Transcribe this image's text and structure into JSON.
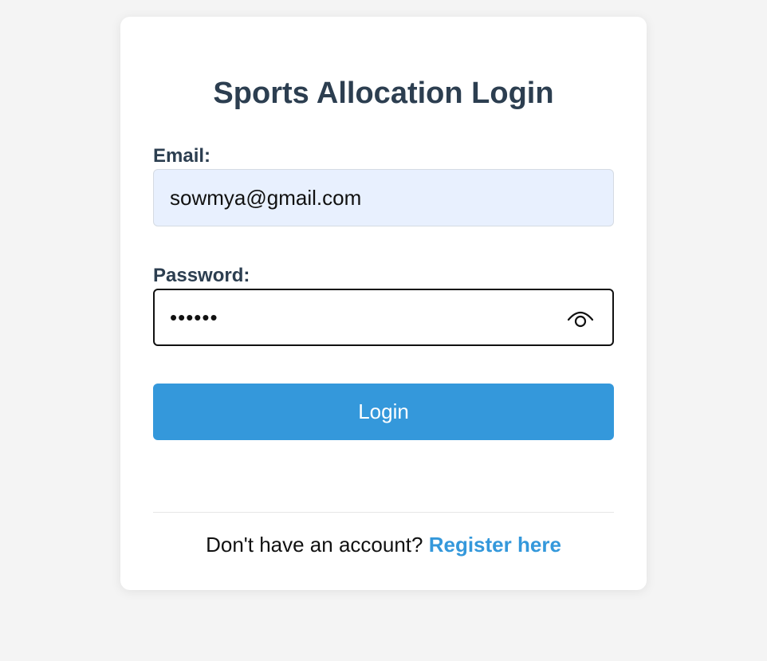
{
  "login": {
    "title": "Sports Allocation Login",
    "email_label": "Email:",
    "email_value": "sowmya@gmail.com",
    "password_label": "Password:",
    "password_value": "123456",
    "password_toggle_icon": "eye-icon",
    "login_button": "Login",
    "footer_text": "Don't have an account?",
    "register_link": "Register here"
  },
  "colors": {
    "page_bg": "#f4f4f4",
    "card_bg": "#ffffff",
    "heading": "#2c3e50",
    "accent": "#3498db",
    "autofill_bg": "#e8f0fe"
  }
}
